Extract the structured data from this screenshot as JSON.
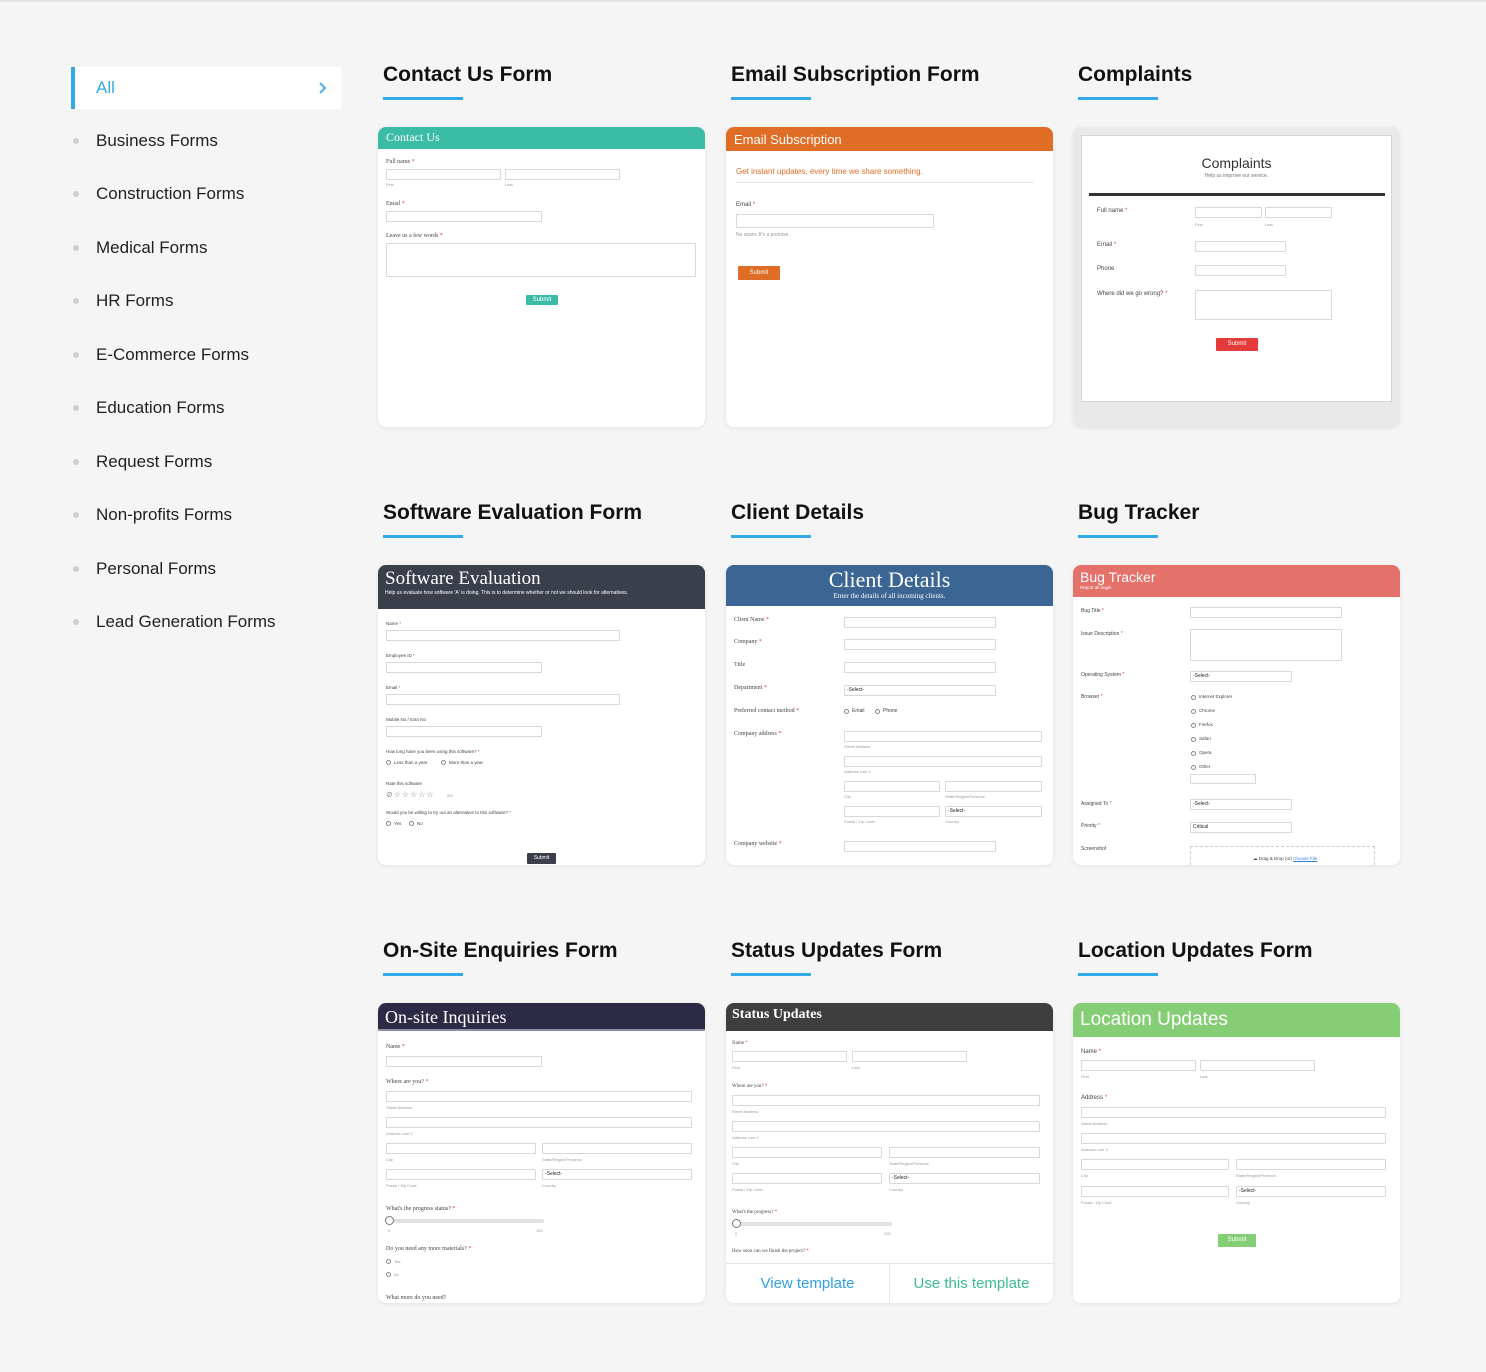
{
  "sidebar": {
    "active": "All",
    "items": [
      "Business Forms",
      "Construction Forms",
      "Medical Forms",
      "HR Forms",
      "E-Commerce Forms",
      "Education Forms",
      "Request Forms",
      "Non-profits Forms",
      "Personal Forms",
      "Lead Generation Forms"
    ]
  },
  "cards": [
    {
      "title": "Contact Us Form"
    },
    {
      "title": "Email Subscription Form"
    },
    {
      "title": "Complaints"
    },
    {
      "title": "Software Evaluation Form"
    },
    {
      "title": "Client Details"
    },
    {
      "title": "Bug Tracker"
    },
    {
      "title": "On-Site Enquiries Form"
    },
    {
      "title": "Status Updates Form"
    },
    {
      "title": "Location Updates Form"
    }
  ],
  "previews": {
    "contact": {
      "header": "Contact Us",
      "full_name": "Full name",
      "first": "First",
      "last": "Last",
      "email": "Email",
      "message": "Leave us a few words",
      "submit": "Submit"
    },
    "email": {
      "header": "Email Subscription",
      "tagline": "Get instant updates, every time we share something.",
      "email": "Email",
      "hint": "No spam. It's a promise.",
      "submit": "Submit"
    },
    "complaints": {
      "title": "Complaints",
      "subtitle": "Help us improve our service.",
      "full_name": "Full name",
      "first": "First",
      "last": "Last",
      "email": "Email",
      "phone": "Phone",
      "wrong": "Where did we go wrong?",
      "submit": "Submit"
    },
    "software": {
      "title": "Software Evaluation",
      "subtitle": "Help us evaluate how software 'A' is doing. This is to determine whether or not we should look for alternatives.",
      "name": "Name",
      "employee": "Employee ID",
      "email": "Email",
      "mobile": "Mobile No / Extn No",
      "howlong": "How long have you been using this software?",
      "opt1": "Less than a year",
      "opt2": "More than a year",
      "rate": "Rate this software",
      "rate_value": "0/5",
      "alt": "Would you be willing to try out an alternative to this software?",
      "yes": "Yes",
      "no": "No",
      "submit": "Submit"
    },
    "client": {
      "title": "Client Details",
      "subtitle": "Enter the details of all incoming clients.",
      "client_name": "Client Name",
      "company": "Company",
      "title_field": "Title",
      "department": "Department",
      "select": "-Select-",
      "preferred": "Preferred contact method",
      "opt_email": "Email",
      "opt_phone": "Phone",
      "address": "Company address",
      "street": "Street Address",
      "line2": "Address Line 2",
      "city": "City",
      "state": "State/Region/Province",
      "postal": "Postal / Zip Code",
      "country": "Country",
      "website": "Company website"
    },
    "bug": {
      "title": "Bug Tracker",
      "subtitle": "Report all bugs!",
      "bug_title": "Bug Title",
      "issue": "Issue Description",
      "os": "Operating System",
      "select": "-Select-",
      "browser": "Browser",
      "browsers": [
        "Internet Explorer",
        "Chrome",
        "Firefox",
        "Safari",
        "Opera",
        "Other"
      ],
      "assigned": "Assigned To",
      "priority": "Priority",
      "priority_value": "Critical",
      "screenshot": "Screenshot",
      "drag": "Drag & Drop (or)",
      "choose": "Choose File"
    },
    "onsite": {
      "title": "On-site Inquiries",
      "name": "Name",
      "where": "Where are you?",
      "street": "Street Address",
      "line2": "Address Line 2",
      "city": "City",
      "state": "State/Region/Province",
      "select": "-Select-",
      "postal": "Postal / Zip Code",
      "country": "Country",
      "progress": "What's the progress status?",
      "min": "0",
      "max": "100",
      "materials": "Do you need any more materials?",
      "yes": "Yes",
      "no": "No",
      "more": "What more do you need?"
    },
    "status": {
      "title": "Status Updates",
      "name": "Name",
      "first": "First",
      "last": "Last",
      "where": "Where are you?",
      "street": "Street Address",
      "line2": "Address Line 2",
      "city": "City",
      "state": "State/Region/Province",
      "select": "-Select-",
      "postal": "Postal / Zip Code",
      "country": "Country",
      "progress": "What's the progress?",
      "min": "0",
      "max": "100",
      "finish": "How soon can we finish the project?",
      "view": "View template",
      "use": "Use this template"
    },
    "location": {
      "title": "Location Updates",
      "name": "Name",
      "first": "First",
      "last": "Last",
      "address": "Address",
      "street": "Street Address",
      "line2": "Address Line 2",
      "city": "City",
      "state": "State/Region/Province",
      "select": "-Select-",
      "postal": "Postal / Zip Code",
      "country": "Country",
      "submit": "Submit"
    }
  },
  "colors": {
    "accent": "#32a9e9",
    "contact": "#3bbca7",
    "email": "#e06d25",
    "software": "#3a3f4b",
    "client": "#3b6592",
    "bug": "#e5726a",
    "onsite": "#2c2a45",
    "status": "#3e3e3e",
    "location": "#86ce76"
  }
}
